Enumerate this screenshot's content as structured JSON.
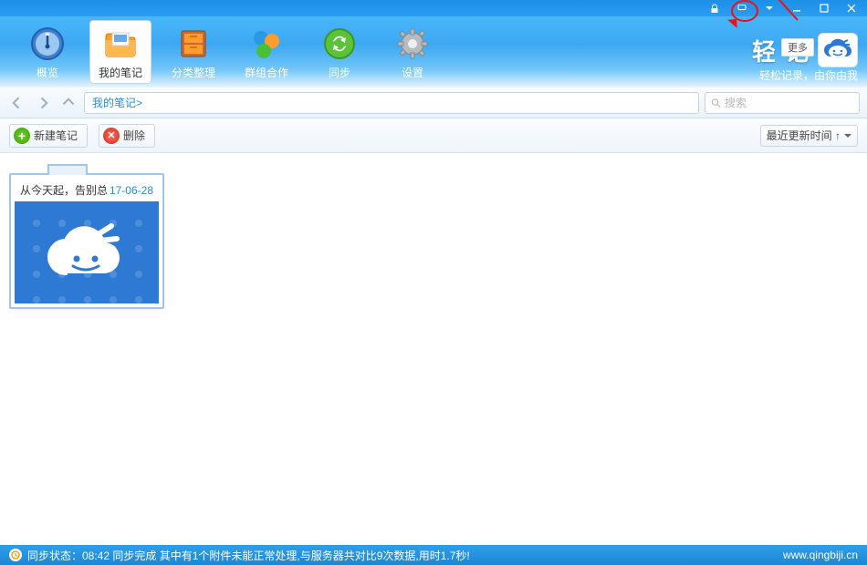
{
  "window": {
    "dropdown_target": "main-menu-dropdown"
  },
  "toolbar": {
    "items": [
      {
        "id": "overview",
        "label": "概览"
      },
      {
        "id": "mynotes",
        "label": "我的笔记",
        "active": true
      },
      {
        "id": "category",
        "label": "分类整理"
      },
      {
        "id": "group",
        "label": "群组合作"
      },
      {
        "id": "sync",
        "label": "同步"
      },
      {
        "id": "settings",
        "label": "设置"
      }
    ]
  },
  "brand": {
    "title_part1": "轻",
    "title_part2": "记",
    "more_label": "更多",
    "tagline": "轻松记录，由你由我"
  },
  "nav": {
    "breadcrumb": "我的笔记>"
  },
  "search": {
    "placeholder": "搜索"
  },
  "actions": {
    "new_note": "新建笔记",
    "delete": "删除",
    "sort_label": "最近更新时间 ↑"
  },
  "notes": [
    {
      "title": "从今天起，告别总",
      "date": "17-06-28"
    }
  ],
  "status": {
    "text": "同步状态：08:42 同步完成 其中有1个附件未能正常处理,与服务器共对比9次数据,用时1.7秒!",
    "website": "www.qingbiji.cn"
  }
}
